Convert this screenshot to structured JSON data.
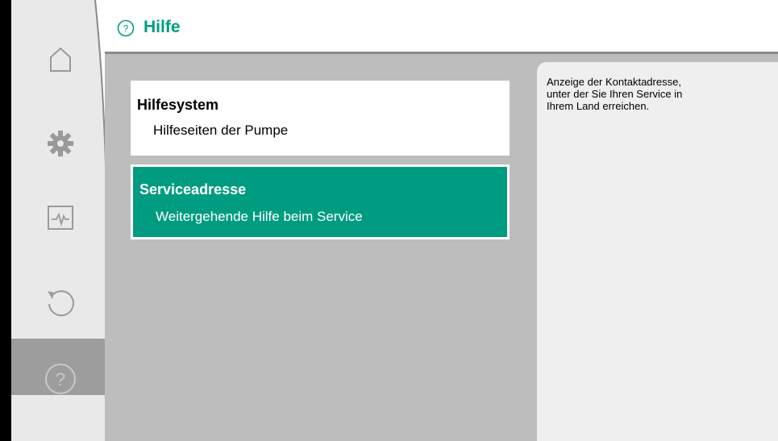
{
  "header": {
    "title": "Hilfe",
    "icon": "help-circle-icon"
  },
  "sidebar": {
    "items": [
      {
        "id": "home",
        "icon": "home-icon",
        "active": false
      },
      {
        "id": "settings",
        "icon": "gear-icon",
        "active": false
      },
      {
        "id": "diagnostics",
        "icon": "pulse-monitor-icon",
        "active": false
      },
      {
        "id": "reset",
        "icon": "undo-icon",
        "active": false
      },
      {
        "id": "help",
        "icon": "help-circle-icon",
        "active": true
      }
    ]
  },
  "menu": {
    "items": [
      {
        "title": "Hilfesystem",
        "subtitle": "Hilfeseiten der Pumpe",
        "selected": false
      },
      {
        "title": "Serviceadresse",
        "subtitle": "Weitergehende Hilfe beim Service",
        "selected": true
      }
    ]
  },
  "info_panel": {
    "text": "Anzeige der Kontaktadresse, unter der Sie Ihren Service in Ihrem Land erreichen."
  },
  "colors": {
    "accent": "#009c82",
    "panel_gray": "#bdbdbd",
    "info_bg": "#efefef"
  }
}
